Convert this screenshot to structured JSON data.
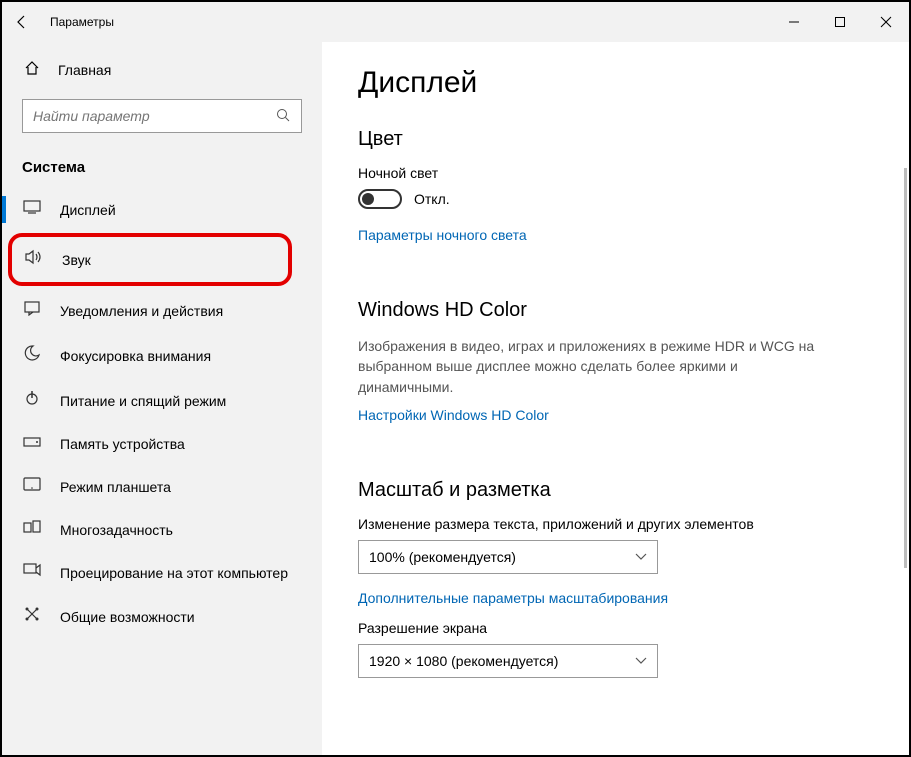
{
  "window": {
    "title": "Параметры"
  },
  "sidebar": {
    "home": "Главная",
    "search_placeholder": "Найти параметр",
    "category": "Система",
    "items": [
      {
        "label": "Дисплей"
      },
      {
        "label": "Звук"
      },
      {
        "label": "Уведомления и действия"
      },
      {
        "label": "Фокусировка внимания"
      },
      {
        "label": "Питание и спящий режим"
      },
      {
        "label": "Память устройства"
      },
      {
        "label": "Режим планшета"
      },
      {
        "label": "Многозадачность"
      },
      {
        "label": "Проецирование на этот компьютер"
      },
      {
        "label": "Общие возможности"
      }
    ]
  },
  "main": {
    "title": "Дисплей",
    "color": {
      "heading": "Цвет",
      "nightlight_label": "Ночной свет",
      "toggle_state": "Откл.",
      "nightlight_link": "Параметры ночного света"
    },
    "hdcolor": {
      "heading": "Windows HD Color",
      "desc": "Изображения в видео, играх и приложениях в режиме HDR и WCG на выбранном выше дисплее можно сделать более яркими и динамичными.",
      "link": "Настройки Windows HD Color"
    },
    "scale": {
      "heading": "Масштаб и разметка",
      "scale_label": "Изменение размера текста, приложений и других элементов",
      "scale_value": "100% (рекомендуется)",
      "extra_link": "Дополнительные параметры масштабирования",
      "resolution_label": "Разрешение экрана",
      "resolution_value": "1920 × 1080 (рекомендуется)"
    }
  }
}
